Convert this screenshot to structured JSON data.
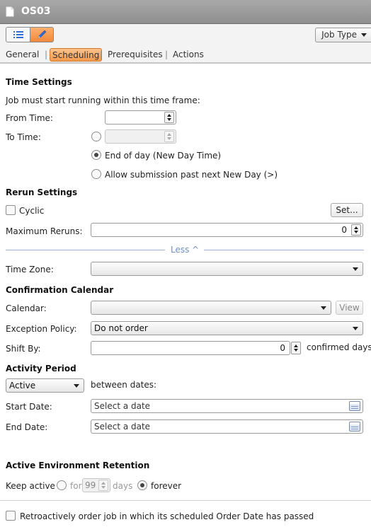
{
  "window": {
    "title": "OS03"
  },
  "toolbar": {
    "job_type_label": "Job Type"
  },
  "tabs": [
    {
      "label": "General",
      "active": false
    },
    {
      "label": "Scheduling",
      "active": true
    },
    {
      "label": "Prerequisites",
      "active": false
    },
    {
      "label": "Actions",
      "active": false
    }
  ],
  "time_settings": {
    "heading": "Time Settings",
    "intro": "Job must start running within this time frame:",
    "from_time_label": "From Time:",
    "from_time_value": "",
    "to_time_label": "To Time:",
    "to_time_value": "",
    "end_of_day_label": "End of day (New Day Time)",
    "allow_submission_label": "Allow submission past next New Day (>)",
    "selected_option": "End of day (New Day Time)"
  },
  "rerun_settings": {
    "heading": "Rerun Settings",
    "cyclic_label": "Cyclic",
    "cyclic_checked": false,
    "set_button": "Set...",
    "max_reruns_label": "Maximum Reruns:",
    "max_reruns_value": "0",
    "less_toggle": "Less ^",
    "time_zone_label": "Time Zone:",
    "time_zone_value": ""
  },
  "confirmation_calendar": {
    "heading": "Confirmation Calendar",
    "calendar_label": "Calendar:",
    "calendar_value": "",
    "view_button": "View",
    "exception_policy_label": "Exception Policy:",
    "exception_policy_value": "Do not order",
    "shift_by_label": "Shift By:",
    "shift_by_value": "0",
    "shift_by_unit": "confirmed days"
  },
  "activity_period": {
    "heading": "Activity Period",
    "mode_value": "Active",
    "between_label": "between dates:",
    "start_date_label": "Start Date:",
    "start_date_placeholder": "Select a date",
    "end_date_label": "End Date:",
    "end_date_placeholder": "Select a date"
  },
  "retention": {
    "heading": "Active Environment Retention",
    "keep_active_label": "Keep active",
    "for_label": "for",
    "days_value": "99",
    "days_label": "days",
    "forever_label": "forever",
    "selected_option": "forever"
  },
  "footer": {
    "retro_label": "Retroactively order job in which its scheduled Order Date has passed",
    "retro_checked": false
  },
  "colors": {
    "accent_orange": "#f49a4d",
    "title_bar": "#9a9a9a",
    "link_blue": "#6d8fc2"
  }
}
